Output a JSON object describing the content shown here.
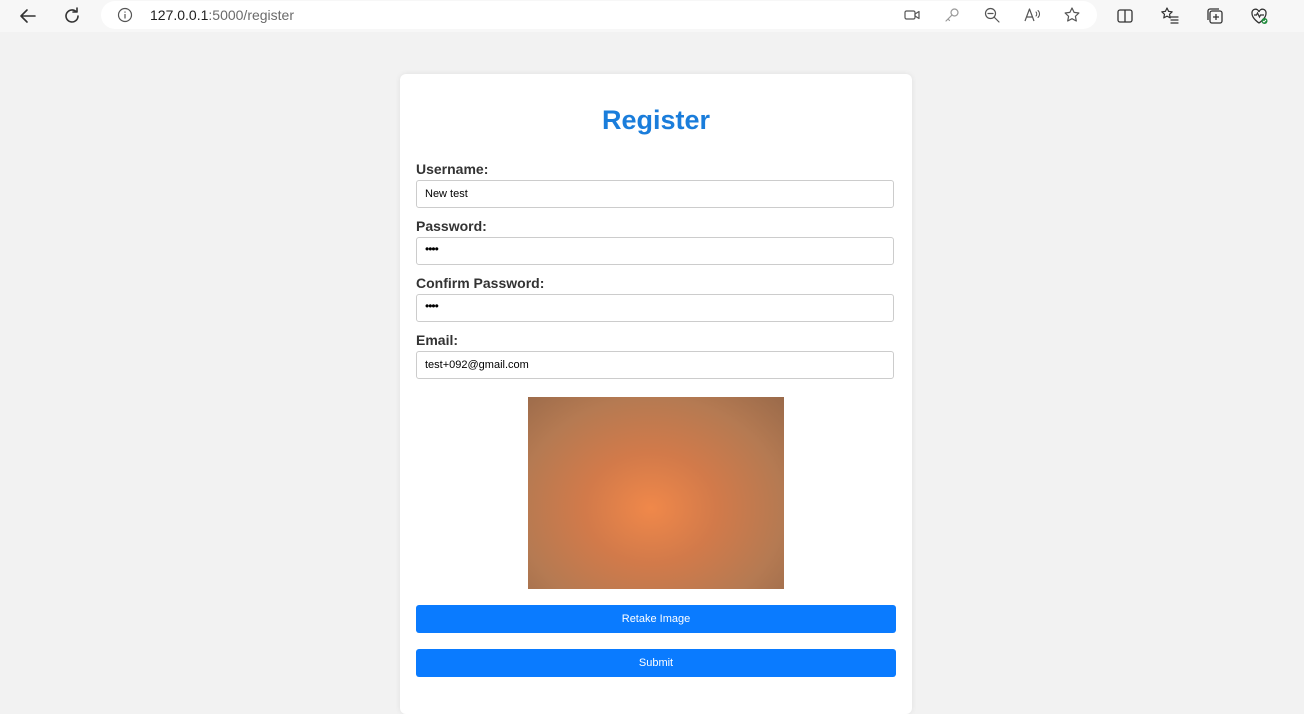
{
  "browser": {
    "url_host": "127.0.0.1",
    "url_path": ":5000/register",
    "icons": [
      "back-arrow-icon",
      "refresh-icon",
      "info-icon",
      "video-icon",
      "key-icon",
      "zoom-out-icon",
      "read-aloud-icon",
      "favorite-star-icon",
      "split-screen-icon",
      "favorites-list-icon",
      "collections-icon",
      "browser-essentials-icon"
    ]
  },
  "form": {
    "title": "Register",
    "username_label": "Username:",
    "username_value": "New test",
    "password_label": "Password:",
    "password_value": "••••",
    "confirm_label": "Confirm Password:",
    "confirm_value": "••••",
    "email_label": "Email:",
    "email_value": "test+092@gmail.com",
    "retake_label": "Retake Image",
    "submit_label": "Submit"
  },
  "colors": {
    "accent": "#1a7ddb",
    "button": "#0a7bff",
    "page_bg": "#f2f2f2"
  }
}
